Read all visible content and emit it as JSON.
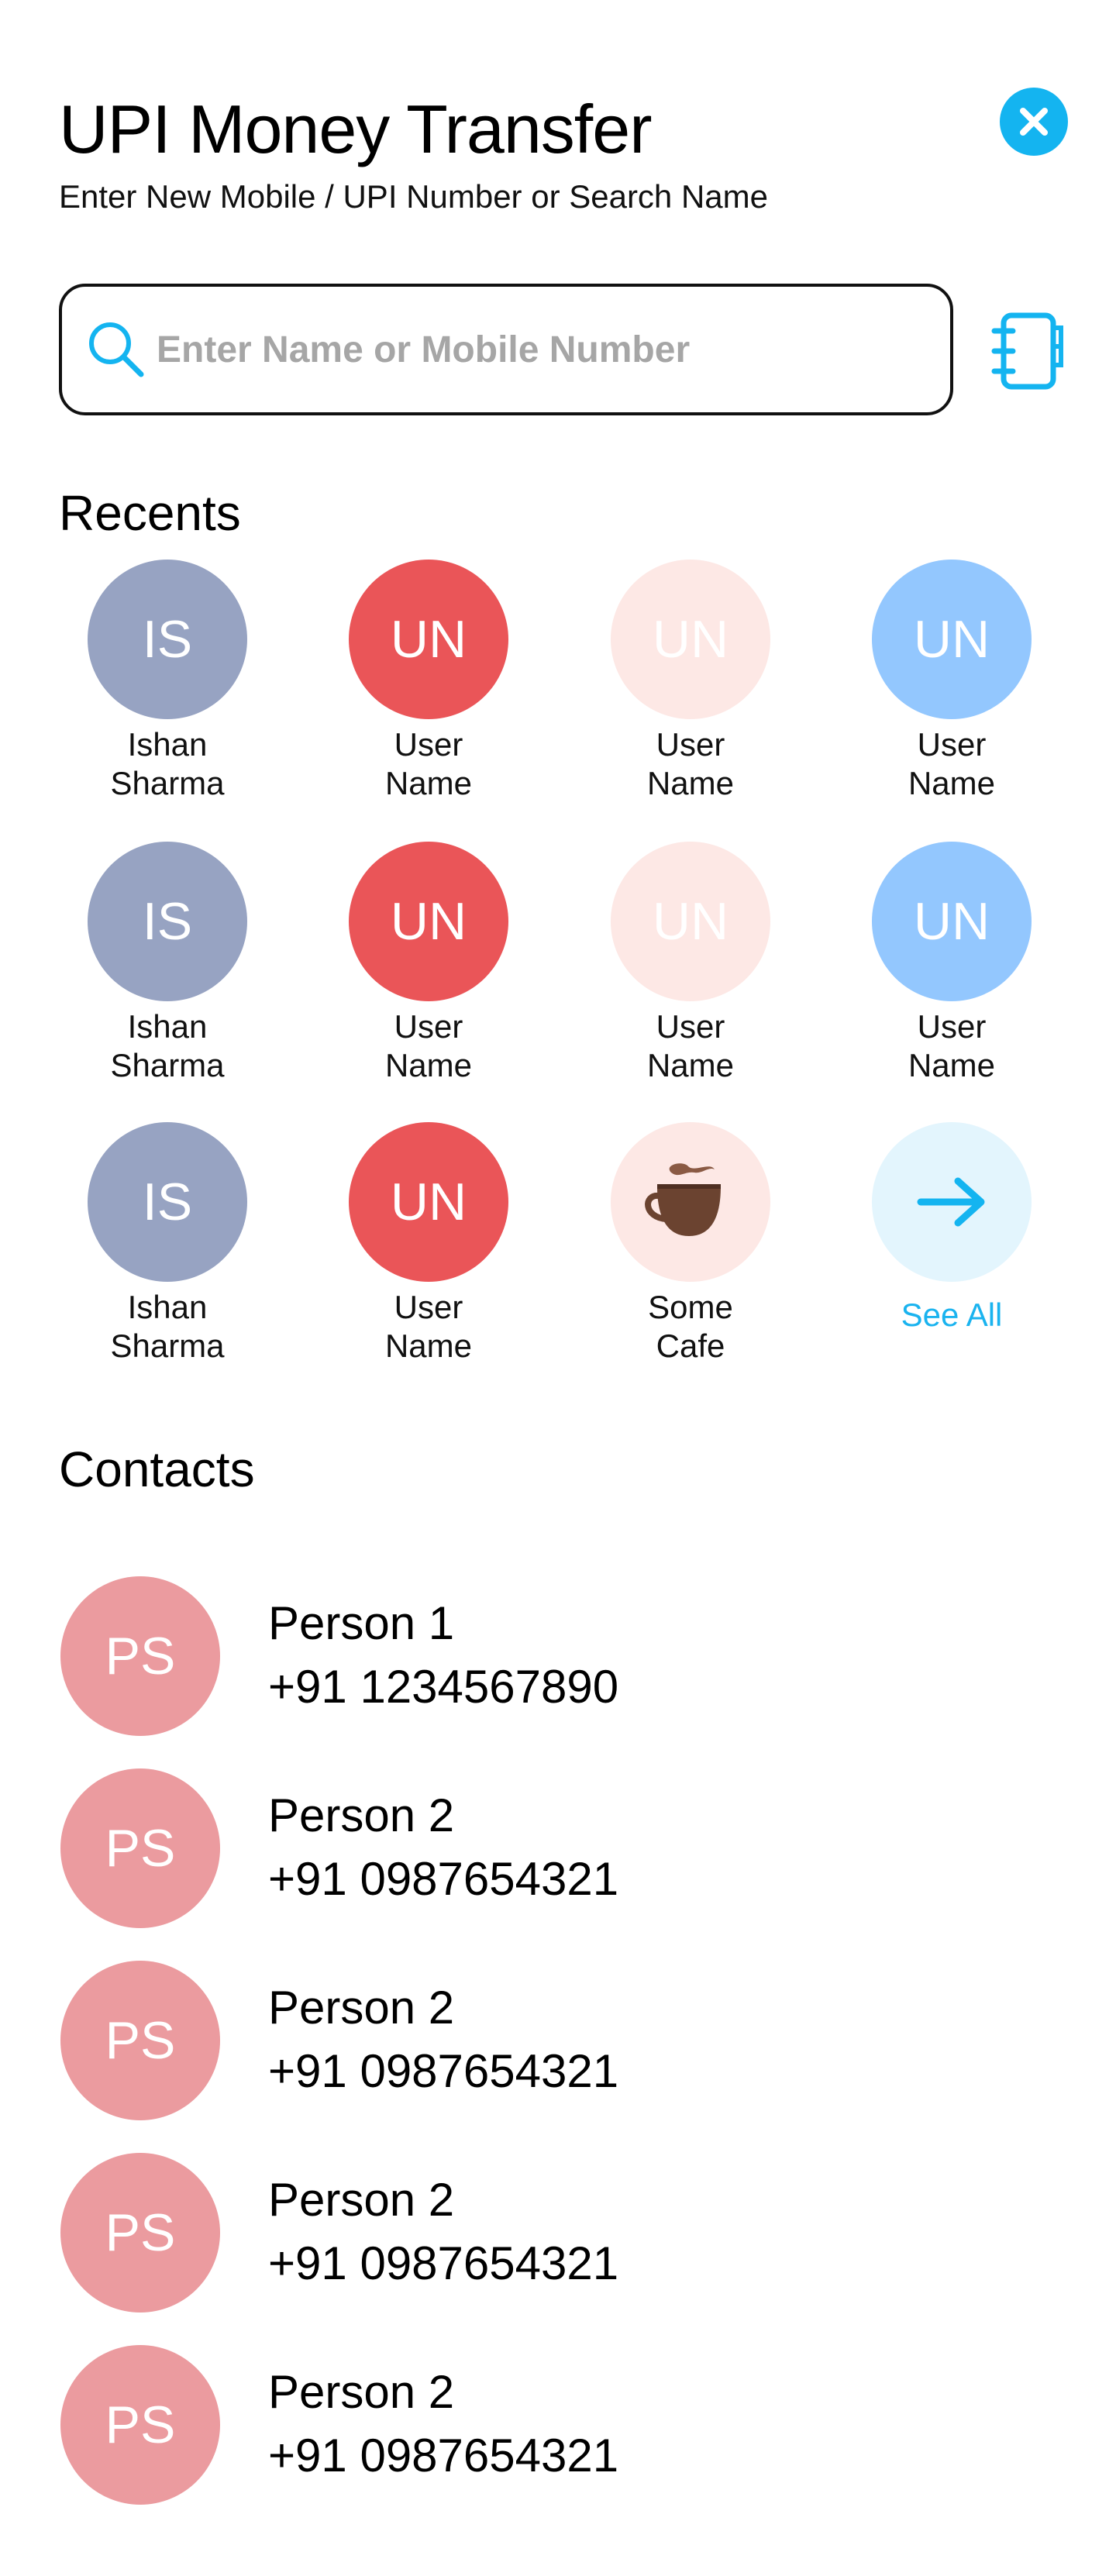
{
  "header": {
    "title": "UPI Money Transfer",
    "subtitle": "Enter New Mobile / UPI Number or Search Name",
    "close_icon": "close-icon",
    "accent_color": "#14b4f0"
  },
  "search": {
    "placeholder": "Enter Name or Mobile Number",
    "value": "",
    "icon": "search-icon",
    "contacts_book_icon": "contact-book-icon"
  },
  "recents": {
    "heading": "Recents",
    "items": [
      {
        "initials": "IS",
        "first": "Ishan",
        "last": "Sharma",
        "color": "#97a3c2"
      },
      {
        "initials": "UN",
        "first": "User",
        "last": "Name",
        "color": "#ea5558"
      },
      {
        "initials": "UN",
        "first": "User",
        "last": "Name",
        "color": "#fde8e5"
      },
      {
        "initials": "UN",
        "first": "User",
        "last": "Name",
        "color": "#93c7fe"
      },
      {
        "initials": "IS",
        "first": "Ishan",
        "last": "Sharma",
        "color": "#97a3c2"
      },
      {
        "initials": "UN",
        "first": "User",
        "last": "Name",
        "color": "#ea5558"
      },
      {
        "initials": "UN",
        "first": "User",
        "last": "Name",
        "color": "#fde8e5"
      },
      {
        "initials": "UN",
        "first": "User",
        "last": "Name",
        "color": "#93c7fe"
      },
      {
        "initials": "IS",
        "first": "Ishan",
        "last": "Sharma",
        "color": "#97a3c2"
      },
      {
        "initials": "UN",
        "first": "User",
        "last": "Name",
        "color": "#ea5558"
      },
      {
        "initials": "",
        "first": "Some",
        "last": "Cafe",
        "color": "#fde8e5",
        "icon": "coffee-cup-icon"
      }
    ],
    "see_all": {
      "label": "See All",
      "icon": "arrow-right-icon",
      "color": "#e3f5fd"
    }
  },
  "contacts": {
    "heading": "Contacts",
    "items": [
      {
        "initials": "PS",
        "name": "Person 1",
        "phone": "+91 1234567890"
      },
      {
        "initials": "PS",
        "name": "Person 2",
        "phone": "+91 0987654321"
      },
      {
        "initials": "PS",
        "name": "Person 2",
        "phone": "+91 0987654321"
      },
      {
        "initials": "PS",
        "name": "Person 2",
        "phone": "+91 0987654321"
      },
      {
        "initials": "PS",
        "name": "Person 2",
        "phone": "+91 0987654321"
      }
    ],
    "avatar_color": "#eb9b9f"
  }
}
